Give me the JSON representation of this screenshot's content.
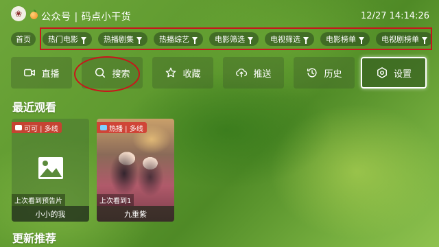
{
  "header": {
    "logo_glyph": "❀",
    "title": "公众号 | 码点小干货",
    "datetime": "12/27 14:14:26"
  },
  "categories": {
    "home": "首页",
    "items": [
      {
        "label": "热门电影"
      },
      {
        "label": "热播剧集"
      },
      {
        "label": "热播综艺"
      },
      {
        "label": "电影筛选"
      },
      {
        "label": "电视筛选"
      },
      {
        "label": "电影榜单"
      },
      {
        "label": "电视剧榜单"
      }
    ]
  },
  "actions": [
    {
      "label": "直播",
      "icon": "live-camera-icon"
    },
    {
      "label": "搜索",
      "icon": "search-icon"
    },
    {
      "label": "收藏",
      "icon": "star-icon"
    },
    {
      "label": "推送",
      "icon": "cloud-upload-icon"
    },
    {
      "label": "历史",
      "icon": "history-icon"
    },
    {
      "label": "设置",
      "icon": "settings-icon",
      "focused": true
    }
  ],
  "sections": {
    "recent": "最近观看",
    "recommend": "更新推荐"
  },
  "recent_items": [
    {
      "badge": "可可 | 多线",
      "progress": "上次看到预告片",
      "name": "小小的我"
    },
    {
      "badge": "热播 | 多线",
      "progress": "上次看到1",
      "name": "九重紫"
    }
  ],
  "colors": {
    "highlight_red": "#c8161b",
    "chip_bg": "#3c5a28"
  }
}
